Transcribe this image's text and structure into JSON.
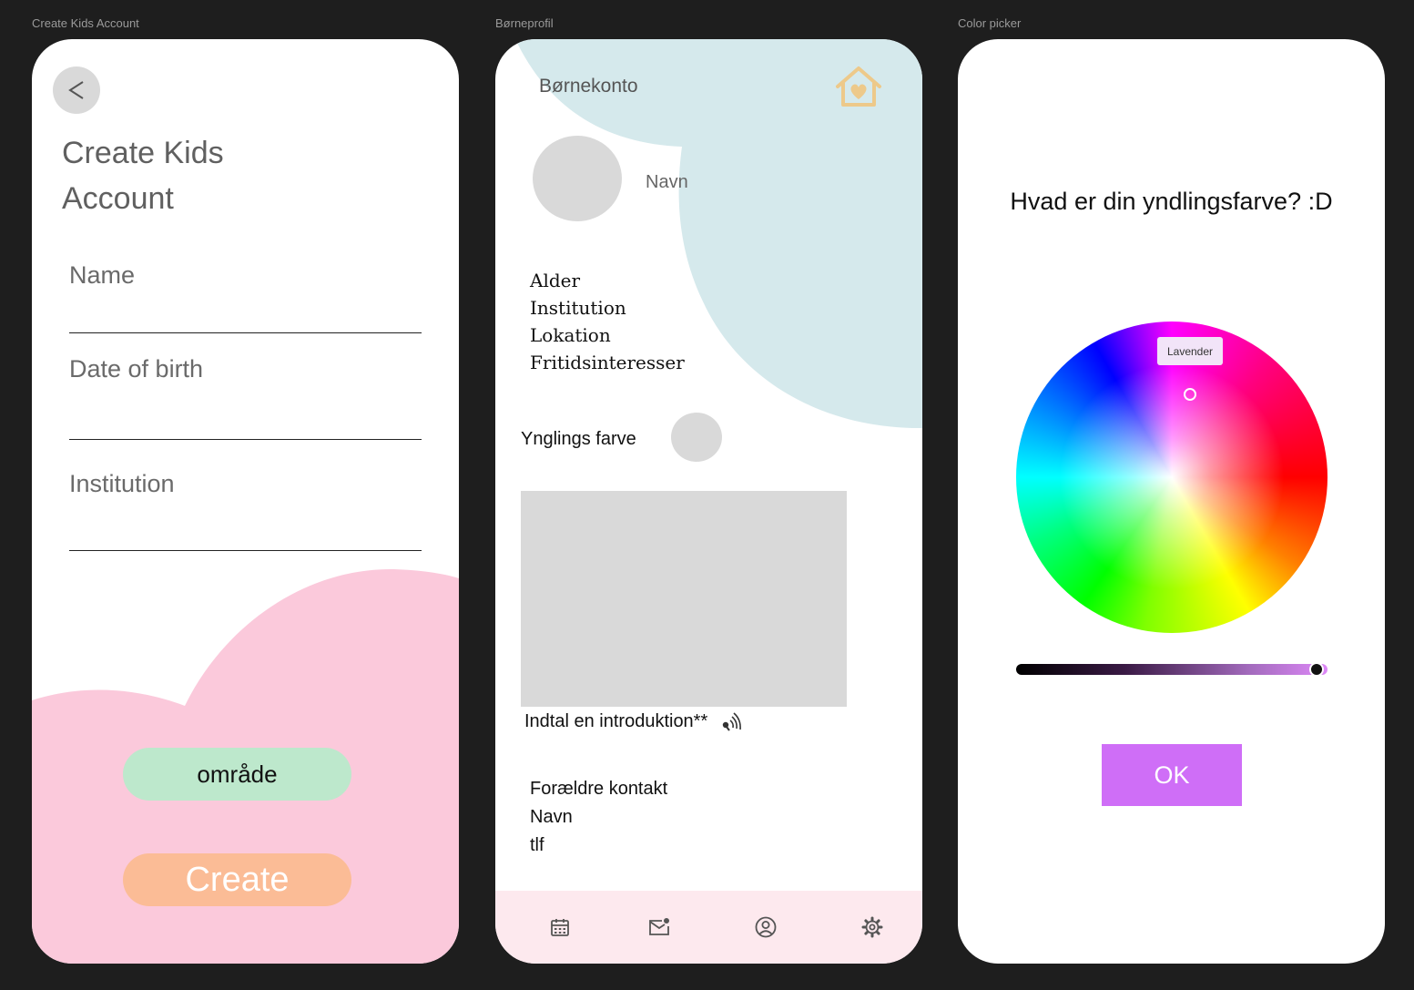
{
  "frames": {
    "kids_account": "Create Kids Account",
    "profile": "Børneprofil",
    "color_picker": "Color picker"
  },
  "kids_account": {
    "back_label": "<",
    "title": "Create Kids Account",
    "fields": {
      "name": "Name",
      "dob": "Date of birth",
      "institution": "Institution"
    },
    "area_button": "område",
    "create_button": "Create",
    "colors": {
      "blob": "#fbc9db",
      "area": "#bde8cc",
      "create": "#fbbc96"
    }
  },
  "profile": {
    "header": "Børnekonto",
    "name": "Navn",
    "info": [
      "Alder",
      "Institution",
      "Lokation",
      "Fritidsinteresser"
    ],
    "favorite_color_label": "Ynglings farve",
    "intro_label": "Indtal en introduktion**",
    "parent_contact": {
      "title": "Forældre kontakt",
      "name": "Navn",
      "phone": "tlf"
    },
    "nav_icons": [
      "calendar-icon",
      "mail-icon",
      "profile-icon",
      "settings-icon"
    ],
    "colors": {
      "bubble": "#d5e9ec",
      "nav": "#fde9ee",
      "home_icon": "#edc98a"
    }
  },
  "color_picker": {
    "question": "Hvad er din yndlingsfarve? :D",
    "tooltip": "Lavender",
    "brightness": 0.96,
    "ok_button": "OK",
    "colors": {
      "ok": "#cf6ef7",
      "tooltip": "#f2e4f8"
    }
  }
}
